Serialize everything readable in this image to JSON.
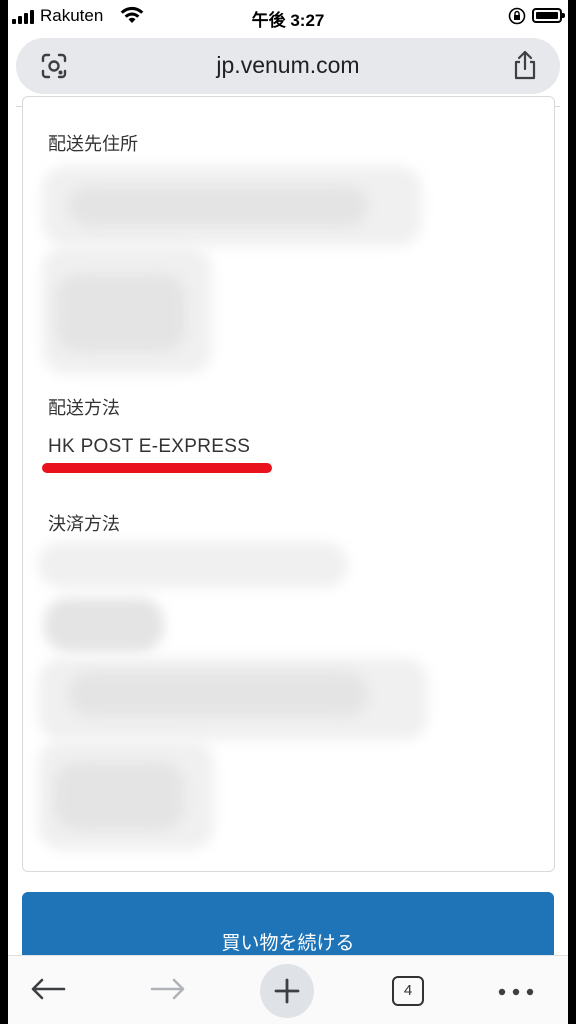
{
  "status_bar": {
    "carrier": "Rakuten",
    "time": "午後 3:27"
  },
  "browser": {
    "url": "jp.venum.com",
    "tab_count": "4"
  },
  "order": {
    "shipping_address_label": "配送先住所",
    "shipping_method_label": "配送方法",
    "shipping_method_value": "HK POST E-EXPRESS",
    "payment_method_label": "決済方法"
  },
  "cta": {
    "continue_shopping": "買い物を続ける"
  },
  "colors": {
    "accent_button": "#1f73b7",
    "highlight_underline": "#e8111c"
  },
  "icons": [
    "signal-icon",
    "wifi-icon",
    "orientation-lock-icon",
    "battery-icon",
    "lens-icon",
    "share-icon",
    "back-icon",
    "forward-icon",
    "new-tab-icon",
    "tabs-icon",
    "more-icon"
  ]
}
